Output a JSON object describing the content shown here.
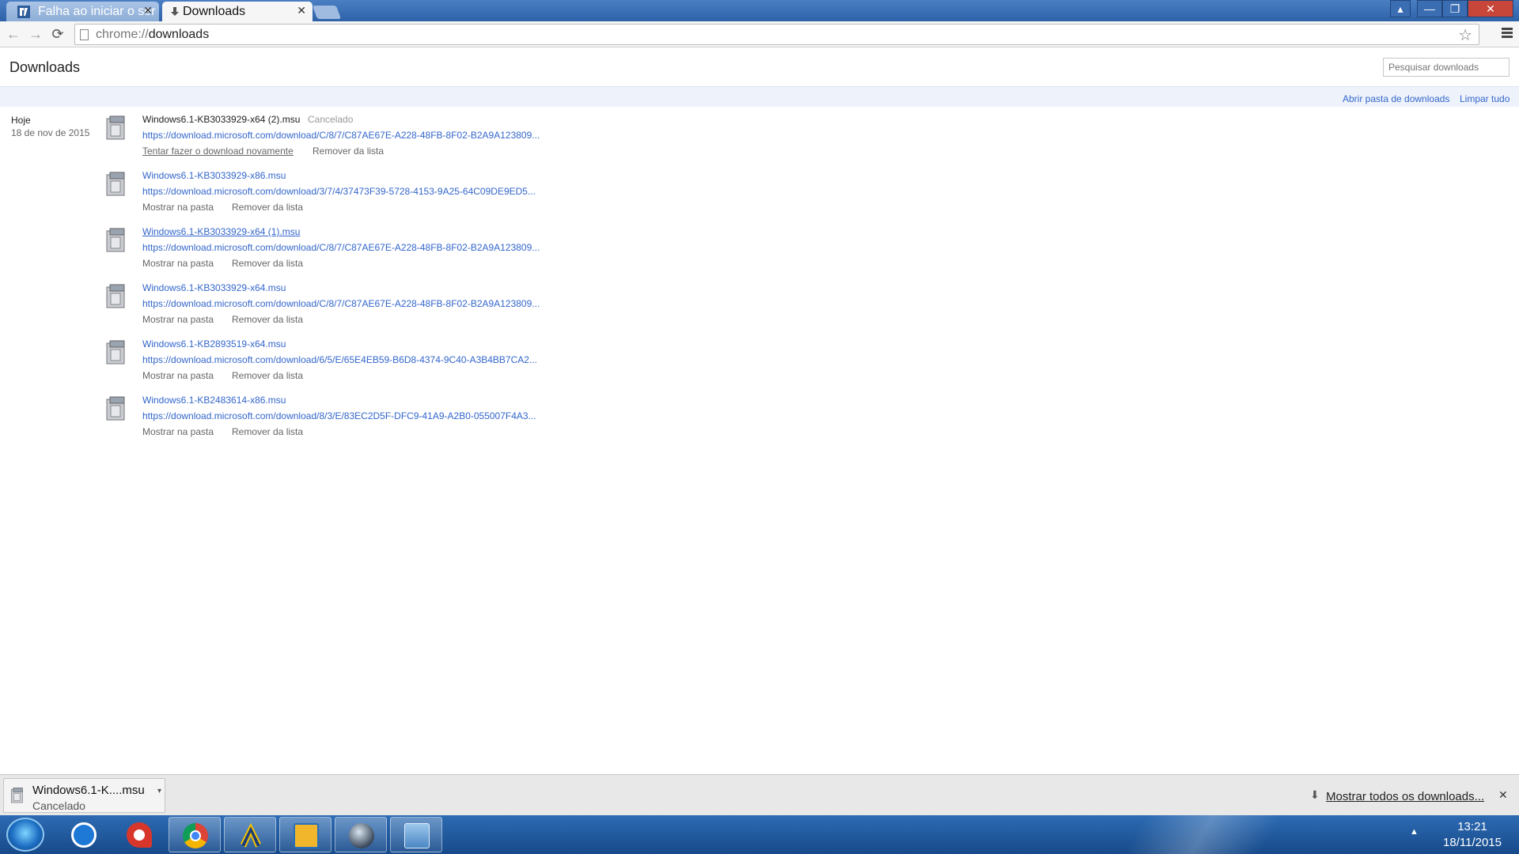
{
  "tabs": [
    {
      "label": "Falha ao iniciar o ser",
      "active": false
    },
    {
      "label": "Downloads",
      "active": true
    }
  ],
  "window_controls": [
    "—",
    "❐",
    "✕"
  ],
  "omnibox": {
    "scheme": "chrome://",
    "host": "downloads"
  },
  "page": {
    "title": "Downloads",
    "search_placeholder": "Pesquisar downloads",
    "open_folder": "Abrir pasta de downloads",
    "clear_all": "Limpar tudo"
  },
  "date_group": {
    "today": "Hoje",
    "date": "18 de nov de 2015"
  },
  "downloads": [
    {
      "name": "Windows6.1-KB3033929-x64 (2).msu",
      "status": "Cancelado",
      "url": "https://download.microsoft.com/download/C/8/7/C87AE67E-A228-48FB-8F02-B2A9A123809...",
      "action1": "Tentar fazer o download novamente",
      "action2": "Remover da lista"
    },
    {
      "name": "Windows6.1-KB3033929-x86.msu",
      "status": "",
      "url": "https://download.microsoft.com/download/3/7/4/37473F39-5728-4153-9A25-64C09DE9ED5...",
      "action1": "Mostrar na pasta",
      "action2": "Remover da lista"
    },
    {
      "name": "Windows6.1-KB3033929-x64 (1).msu",
      "status": "",
      "url": "https://download.microsoft.com/download/C/8/7/C87AE67E-A228-48FB-8F02-B2A9A123809...",
      "action1": "Mostrar na pasta",
      "action2": "Remover da lista"
    },
    {
      "name": "Windows6.1-KB3033929-x64.msu",
      "status": "",
      "url": "https://download.microsoft.com/download/C/8/7/C87AE67E-A228-48FB-8F02-B2A9A123809...",
      "action1": "Mostrar na pasta",
      "action2": "Remover da lista"
    },
    {
      "name": "Windows6.1-KB2893519-x64.msu",
      "status": "",
      "url": "https://download.microsoft.com/download/6/5/E/65E4EB59-B6D8-4374-9C40-A3B4BB7CA2...",
      "action1": "Mostrar na pasta",
      "action2": "Remover da lista"
    },
    {
      "name": "Windows6.1-KB2483614-x86.msu",
      "status": "",
      "url": "https://download.microsoft.com/download/8/3/E/83EC2D5F-DFC9-41A9-A2B0-055007F4A3...",
      "action1": "Mostrar na pasta",
      "action2": "Remover da lista"
    }
  ],
  "shelf": {
    "item_name": "Windows6.1-K....msu",
    "item_status": "Cancelado",
    "show_all": "Mostrar todos os downloads..."
  },
  "taskbar": {
    "apps": [
      "teamviewer-icon",
      "ccleaner-icon",
      "chrome-icon",
      "avast-a-icon",
      "folder-app-icon",
      "globe-app-icon",
      "control-panel-icon"
    ],
    "time": "13:21",
    "date": "18/11/2015"
  }
}
